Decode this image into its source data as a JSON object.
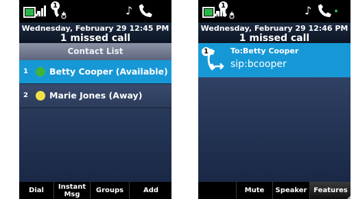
{
  "left_screen": {
    "status": {
      "voicemail_count": "1",
      "icons": [
        "battery-icon",
        "signal-icon",
        "voicemail-icon",
        "note-icon",
        "phone-status-icon"
      ]
    },
    "header": {
      "datetime": "Wednesday, February 29 12:45 PM",
      "missed": "1 missed call"
    },
    "list_title": "Contact List",
    "contacts": [
      {
        "index": "1",
        "name": "Betty Cooper (Available)",
        "status_color": "#3fb43a",
        "selected": true
      },
      {
        "index": "2",
        "name": "Marie Jones (Away)",
        "status_color": "#f2e04a",
        "selected": false
      }
    ],
    "softkeys": [
      "Dial",
      "Instant Msg",
      "Groups",
      "Add"
    ]
  },
  "right_screen": {
    "status": {
      "voicemail_count": "1",
      "icons": [
        "battery-icon",
        "signal-icon",
        "voicemail-icon",
        "note-icon",
        "phone-status-icon",
        "green-dot-icon"
      ]
    },
    "header": {
      "datetime": "Wednesday, February 29 12:46 PM",
      "missed": "1 missed call"
    },
    "call": {
      "line_number": "1",
      "to": "To:Betty Cooper",
      "sip": "sip:bcooper"
    },
    "softkeys": [
      "",
      "Mute",
      "Speaker",
      "Features"
    ]
  },
  "colors": {
    "accent": "#1798d6",
    "available": "#3fb43a",
    "away": "#f2e04a"
  }
}
